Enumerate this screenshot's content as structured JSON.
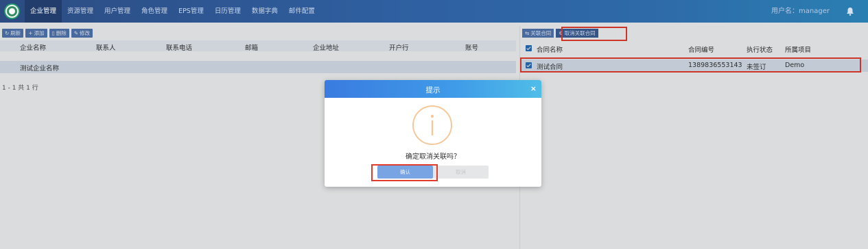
{
  "nav": {
    "items": [
      "企业管理",
      "资源管理",
      "用户管理",
      "角色管理",
      "EPS管理",
      "日历管理",
      "数据字典",
      "邮件配置"
    ],
    "user_label": "用户名：manager"
  },
  "left": {
    "toolbar": {
      "refresh": "刷新",
      "add": "添加",
      "delete": "删除",
      "edit": "修改"
    },
    "columns": [
      "企业名称",
      "联系人",
      "联系电话",
      "邮箱",
      "企业地址",
      "开户行",
      "账号"
    ],
    "rows": [
      {
        "name": "测试企业名称"
      }
    ],
    "pager": "1 - 1 共 1 行"
  },
  "right": {
    "toolbar": {
      "link": "关联合同",
      "unlink": "取消关联合同"
    },
    "columns": [
      "合同名称",
      "合同编号",
      "执行状态",
      "所属项目"
    ],
    "rows": [
      {
        "name": "测试合同",
        "number": "1389836553143",
        "status": "未签订",
        "project": "Demo"
      }
    ]
  },
  "dialog": {
    "title": "提示",
    "close": "×",
    "message": "确定取消关联吗？",
    "ok": "确认",
    "cancel": "取消"
  },
  "colors": {
    "nav_bg": "#2f5fa0",
    "nav_active": "#223d6b",
    "button": "#5277b0",
    "highlight": "#e23a2b",
    "dialog_header": "#3f9be8",
    "info_icon": "#f5c89a"
  }
}
